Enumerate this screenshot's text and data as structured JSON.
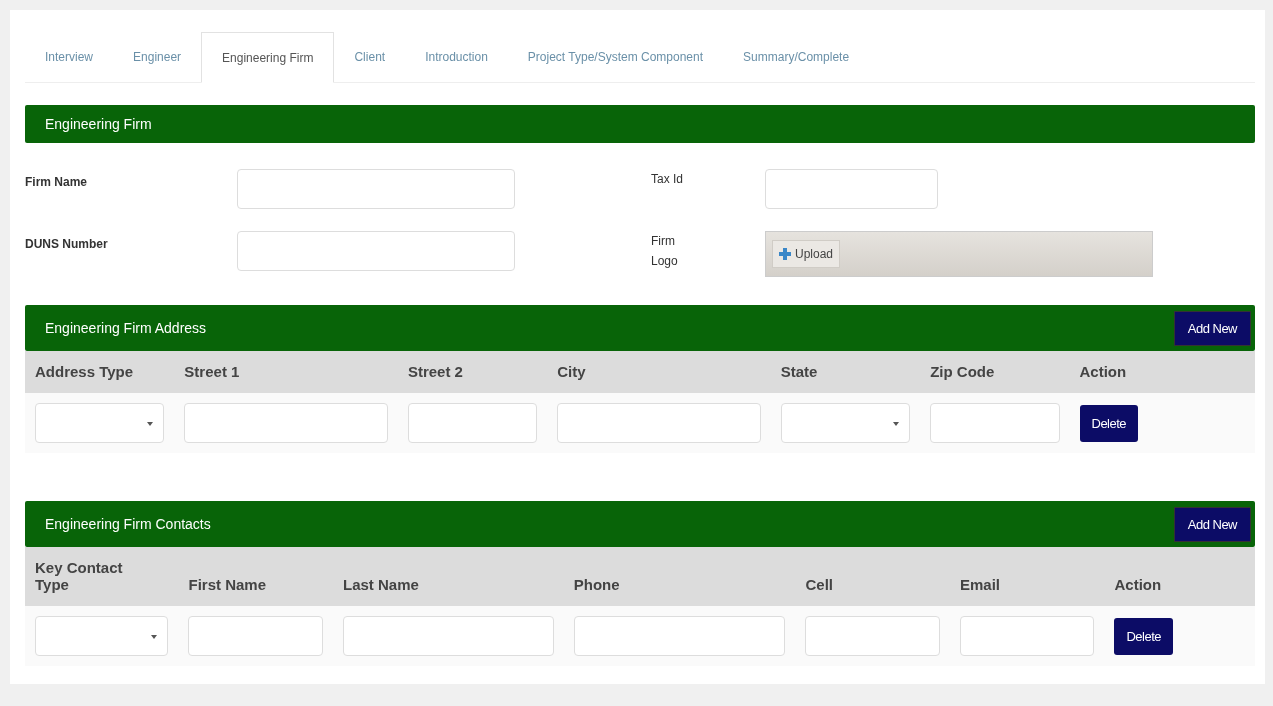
{
  "tabs": [
    {
      "label": "Interview",
      "selected": false
    },
    {
      "label": "Engineer",
      "selected": false
    },
    {
      "label": "Engineering Firm",
      "selected": true
    },
    {
      "label": "Client",
      "selected": false
    },
    {
      "label": "Introduction",
      "selected": false
    },
    {
      "label": "Project Type/System Component",
      "selected": false
    },
    {
      "label": "Summary/Complete",
      "selected": false
    }
  ],
  "firm_section": {
    "title": "Engineering Firm",
    "fields": [
      {
        "label": "Firm Name",
        "kind": "text"
      },
      {
        "label": "Tax Id",
        "kind": "text"
      },
      {
        "label": "DUNS Number",
        "kind": "text"
      },
      {
        "label": "Firm Logo",
        "kind": "upload",
        "button_label": "Upload"
      }
    ]
  },
  "tables": [
    {
      "title": "Engineering Firm Address",
      "add_button": "Add New",
      "columns": [
        "Address Type",
        "Street 1",
        "Street 2",
        "City",
        "State",
        "Zip Code",
        "Action"
      ],
      "rows": [
        {
          "cells": [
            {
              "kind": "select"
            },
            {
              "kind": "text"
            },
            {
              "kind": "text"
            },
            {
              "kind": "text"
            },
            {
              "kind": "select"
            },
            {
              "kind": "text"
            },
            {
              "kind": "button",
              "label": "Delete"
            }
          ]
        }
      ]
    },
    {
      "title": "Engineering Firm Contacts",
      "add_button": "Add New",
      "columns": [
        "Key Contact Type",
        "First Name",
        "Last Name",
        "Phone",
        "Cell",
        "Email",
        "Action"
      ],
      "rows": [
        {
          "cells": [
            {
              "kind": "select"
            },
            {
              "kind": "text"
            },
            {
              "kind": "text"
            },
            {
              "kind": "text"
            },
            {
              "kind": "text"
            },
            {
              "kind": "text"
            },
            {
              "kind": "button",
              "label": "Delete"
            }
          ]
        }
      ]
    }
  ]
}
